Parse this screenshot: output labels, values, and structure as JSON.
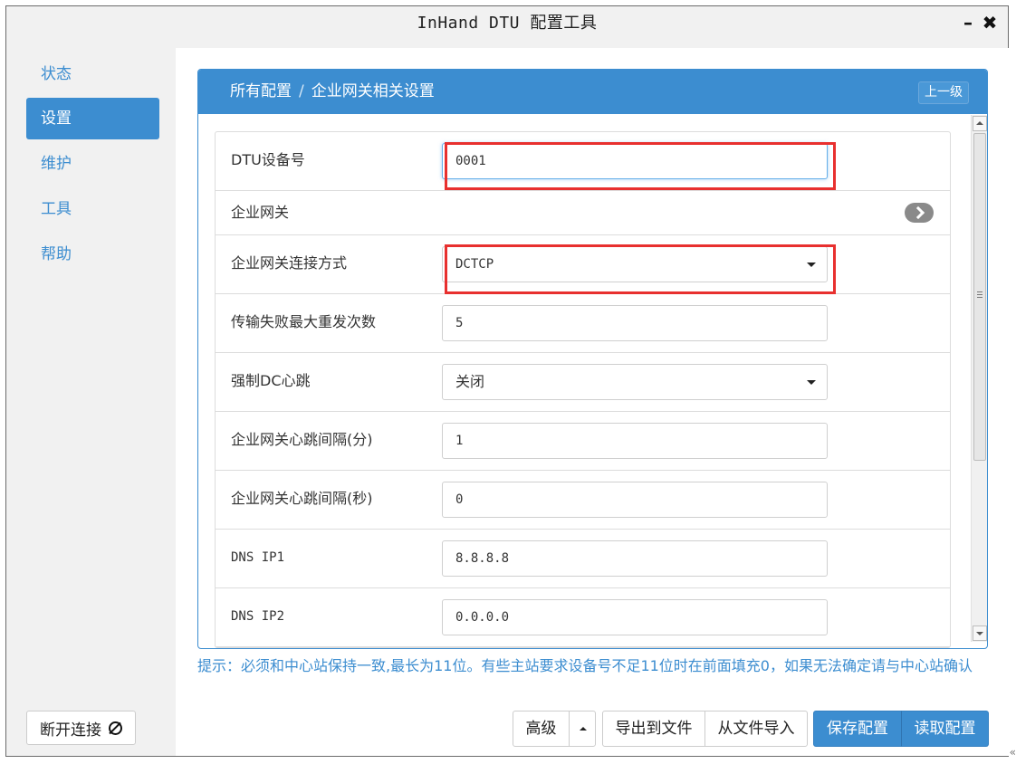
{
  "window": {
    "title": "InHand DTU 配置工具",
    "minimize_label": "–",
    "close_label": "✖"
  },
  "sidebar": {
    "items": [
      {
        "label": "状态",
        "active": false
      },
      {
        "label": "设置",
        "active": true
      },
      {
        "label": "维护",
        "active": false
      },
      {
        "label": "工具",
        "active": false
      },
      {
        "label": "帮助",
        "active": false
      }
    ],
    "disconnect_label": "断开连接"
  },
  "panel": {
    "breadcrumb_root": "所有配置",
    "breadcrumb_sep": "/",
    "breadcrumb_current": "企业网关相关设置",
    "back_label": "上一级"
  },
  "form": {
    "rows": [
      {
        "label": "DTU设备号",
        "value": "0001",
        "type": "text"
      },
      {
        "label": "企业网关",
        "type": "section"
      },
      {
        "label": "企业网关连接方式",
        "value": "DCTCP",
        "type": "select"
      },
      {
        "label": "传输失败最大重发次数",
        "value": "5",
        "type": "text"
      },
      {
        "label": "强制DC心跳",
        "value": "关闭",
        "type": "select"
      },
      {
        "label": "企业网关心跳间隔(分)",
        "value": "1",
        "type": "text"
      },
      {
        "label": "企业网关心跳间隔(秒)",
        "value": "0",
        "type": "text"
      },
      {
        "label": "DNS IP1",
        "value": "8.8.8.8",
        "type": "text"
      },
      {
        "label": "DNS IP2",
        "value": "0.0.0.0",
        "type": "text"
      }
    ]
  },
  "hint": "提示：必须和中心站保持一致,最长为11位。有些主站要求设备号不足11位时在前面填充0，如果无法确定请与中心站确认",
  "toolbar": {
    "advanced_label": "高级",
    "export_label": "导出到文件",
    "import_label": "从文件导入",
    "save_label": "保存配置",
    "read_label": "读取配置"
  },
  "colors": {
    "accent": "#3c8dd0",
    "highlight": "#e8302f"
  }
}
